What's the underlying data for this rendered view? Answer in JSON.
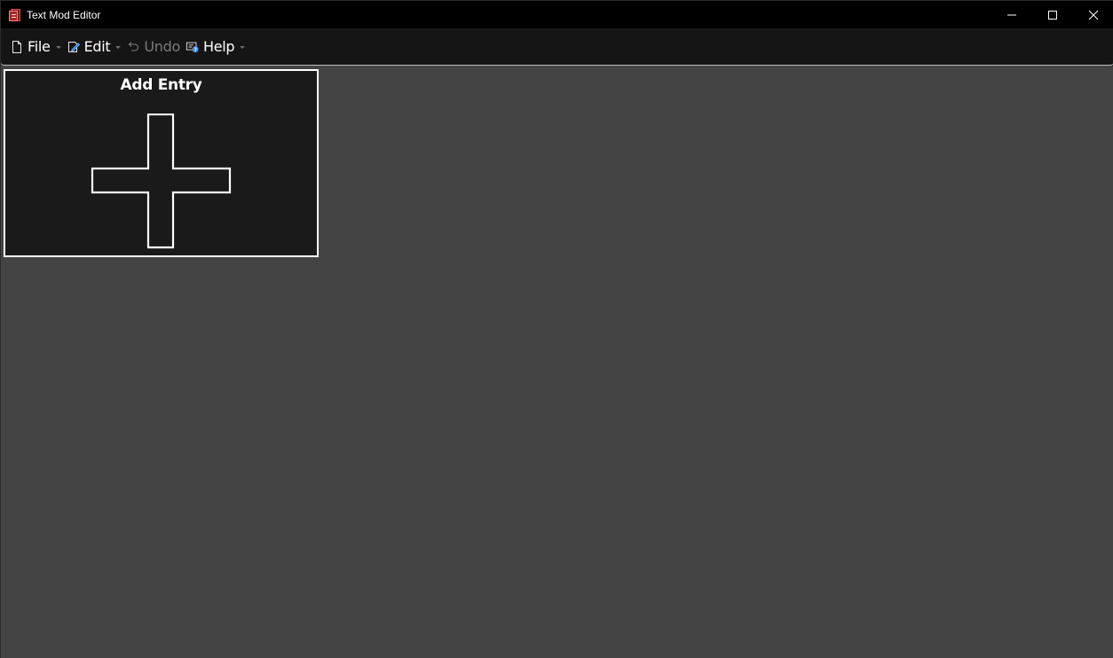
{
  "window": {
    "title": "Text Mod Editor",
    "icon": "app-icon",
    "controls": [
      "minimize-icon",
      "maximize-icon",
      "close-icon"
    ]
  },
  "toolbar": {
    "items": [
      {
        "label": "File",
        "icon": "file-icon",
        "enabled": true,
        "dropdown": true
      },
      {
        "label": "Edit",
        "icon": "edit-icon",
        "enabled": true,
        "dropdown": true
      },
      {
        "label": "Undo",
        "icon": "undo-icon",
        "enabled": false,
        "dropdown": false
      },
      {
        "label": "Help",
        "icon": "help-icon",
        "enabled": true,
        "dropdown": true
      }
    ]
  },
  "main": {
    "add_entry_label": "Add Entry",
    "add_entry_icon": "plus-icon"
  },
  "colors": {
    "titlebar": "#000000",
    "toolbar": "#151515",
    "content_bg": "#444444",
    "card_bg": "#1a1a1a",
    "card_border": "#ffffff",
    "help_accent": "#3c8ee8"
  }
}
